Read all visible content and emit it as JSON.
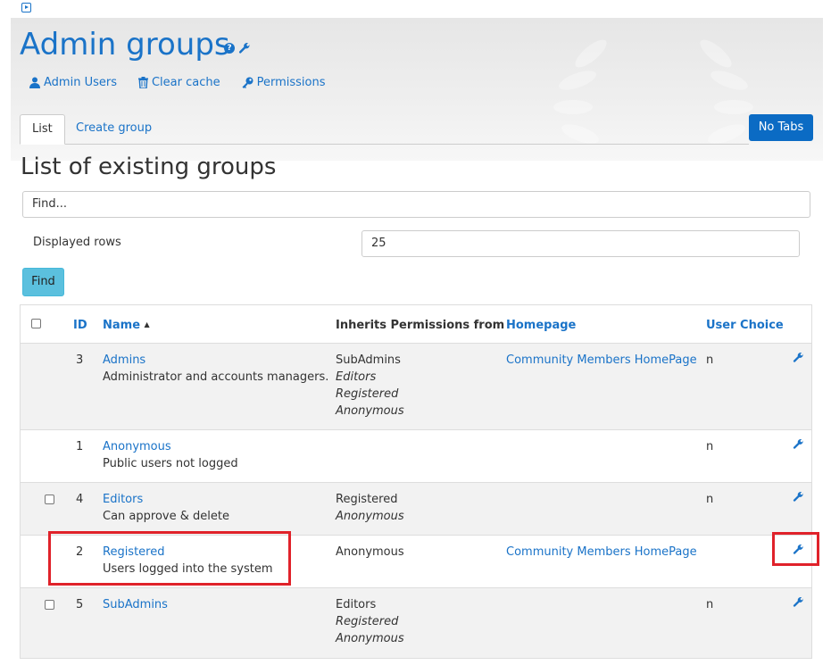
{
  "top_icon": "play-box-icon",
  "title": "Admin groups",
  "actions": [
    {
      "label": "Admin Users",
      "icon": "user-icon"
    },
    {
      "label": "Clear cache",
      "icon": "trash-icon"
    },
    {
      "label": "Permissions",
      "icon": "key-icon"
    }
  ],
  "tabs": [
    {
      "label": "List",
      "active": true
    },
    {
      "label": "Create group",
      "active": false
    }
  ],
  "no_tabs_button": "No Tabs",
  "subtitle": "List of existing groups",
  "find_placeholder": "Find...",
  "displayed_rows_label": "Displayed rows",
  "displayed_rows_value": "25",
  "find_button": "Find",
  "table": {
    "headers": {
      "id": "ID",
      "name": "Name",
      "sort_indicator": "▲",
      "inherits": "Inherits Permissions from",
      "homepage": "Homepage",
      "user_choice": "User Choice"
    },
    "rows": [
      {
        "id": "3",
        "name": "Admins",
        "desc": "Administrator and accounts managers.",
        "inherits_direct": "SubAdmins",
        "inherits_indirect": [
          "Editors",
          "Registered",
          "Anonymous"
        ],
        "homepage": "Community Members HomePage",
        "user_choice": "n",
        "checkbox": false
      },
      {
        "id": "1",
        "name": "Anonymous",
        "desc": "Public users not logged",
        "inherits_direct": "",
        "inherits_indirect": [],
        "homepage": "",
        "user_choice": "n",
        "checkbox": false
      },
      {
        "id": "4",
        "name": "Editors",
        "desc": "Can approve & delete",
        "inherits_direct": "Registered",
        "inherits_indirect": [
          "Anonymous"
        ],
        "homepage": "",
        "user_choice": "n",
        "checkbox": true
      },
      {
        "id": "2",
        "name": "Registered",
        "desc": "Users logged into the system",
        "inherits_direct": "Anonymous",
        "inherits_indirect": [],
        "homepage": "Community Members HomePage",
        "user_choice": "",
        "checkbox": false
      },
      {
        "id": "5",
        "name": "SubAdmins",
        "desc": "",
        "inherits_direct": "Editors",
        "inherits_indirect": [
          "Registered",
          "Anonymous"
        ],
        "homepage": "",
        "user_choice": "n",
        "checkbox": true
      }
    ]
  },
  "colors": {
    "link": "#1a73c8",
    "highlight": "#e0222a",
    "primary_button": "#0b6bc4",
    "find_button": "#5bc0de"
  }
}
